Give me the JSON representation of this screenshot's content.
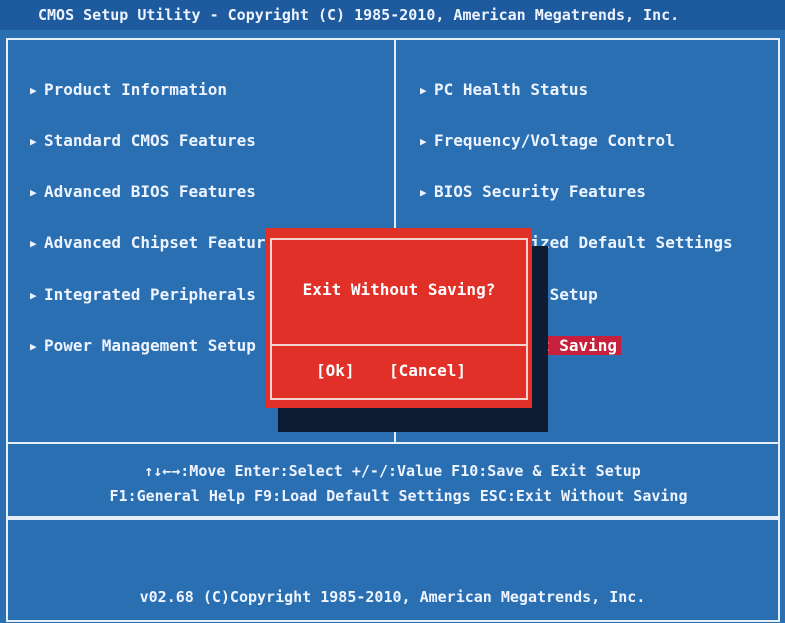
{
  "title_bar": "CMOS Setup Utility - Copyright (C) 1985-2010, American Megatrends, Inc.",
  "arrow_glyph": "▶",
  "left_menu": [
    {
      "label": "Product Information"
    },
    {
      "label": "Standard CMOS Features"
    },
    {
      "label": "Advanced BIOS Features"
    },
    {
      "label": "Advanced Chipset Features"
    },
    {
      "label": "Integrated Peripherals"
    },
    {
      "label": "Power Management Setup"
    }
  ],
  "right_menu": [
    {
      "label": "PC Health Status"
    },
    {
      "label": "Frequency/Voltage Control"
    },
    {
      "label": "BIOS Security Features"
    },
    {
      "label": "Load Optimized Default Settings"
    },
    {
      "label": "Save & Exit Setup"
    },
    {
      "label": "Exit Without Saving",
      "selected": true
    }
  ],
  "help": {
    "line1": "↑↓←→:Move  Enter:Select  +/-/:Value  F10:Save & Exit Setup",
    "line2": "F1:General Help  F9:Load Default Settings  ESC:Exit Without Saving"
  },
  "version_line": "v02.68 (C)Copyright 1985-2010, American Megatrends, Inc.",
  "dialog": {
    "message": "Exit Without Saving?",
    "ok_label": "[Ok]",
    "cancel_label": "[Cancel]"
  },
  "colors": {
    "background": "#2b6fb3",
    "dialog": "#e03028",
    "highlight": "#c8203c",
    "text": "#eef4ff"
  }
}
